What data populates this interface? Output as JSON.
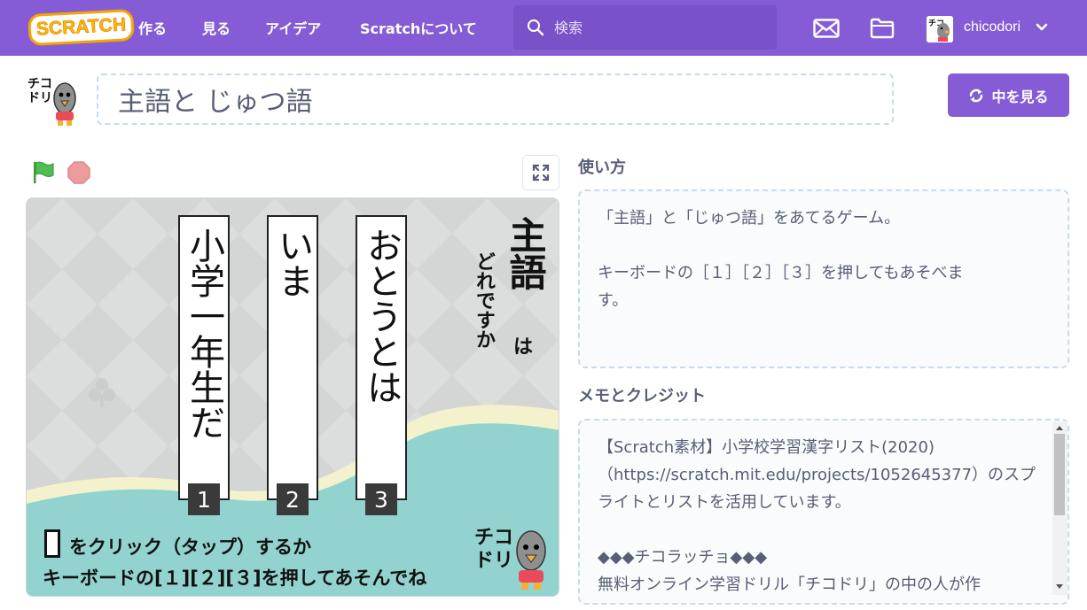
{
  "nav": {
    "logo": "SCRATCH",
    "links": [
      "作る",
      "見る",
      "アイデア",
      "Scratchについて"
    ],
    "search_placeholder": "検索",
    "username": "chicodori"
  },
  "project": {
    "title": "主語と じゅつ語",
    "see_inside": "中を見る"
  },
  "stage": {
    "cards": [
      {
        "text": "小学一年生だ",
        "number": "1"
      },
      {
        "text": "いま",
        "number": "2"
      },
      {
        "text": "おとうとは",
        "number": "3"
      }
    ],
    "heading_main": "主語",
    "heading_ha": "は",
    "heading_sub": "どれですか",
    "instruction_line1": "をクリック（タップ）するか",
    "instruction_line2": "キーボードの[１][２][３]を押してあそんでね",
    "logo_text": "チコドリ"
  },
  "instructions": {
    "label": "使い方",
    "lines": [
      "「主語」と「じゅつ語」をあてるゲーム。",
      "",
      "キーボードの［１］［２］［３］を押してもあそべま",
      "す。"
    ]
  },
  "notes": {
    "label": "メモとクレジット",
    "lines": [
      "【Scratch素材】小学校学習漢字リスト(2020)",
      "（https://scratch.mit.edu/projects/1052645377）のスプ",
      "ライトとリストを活用しています。",
      "",
      "◆◆◆チコラッチョ◆◆◆",
      "無料オンライン学習ドリル「チコドリ」の中の人が作"
    ]
  },
  "colors": {
    "nav_bg": "#855cd6",
    "search_bg": "#7952c9",
    "button": "#855cd6",
    "stage_bg": "#d6d8d8",
    "wave_teal": "#93d3cf",
    "wave_cream": "#f4f2cc",
    "text_gray": "#575e75",
    "flag_green": "#4cbf56",
    "stop_red": "#ec9c9c"
  }
}
